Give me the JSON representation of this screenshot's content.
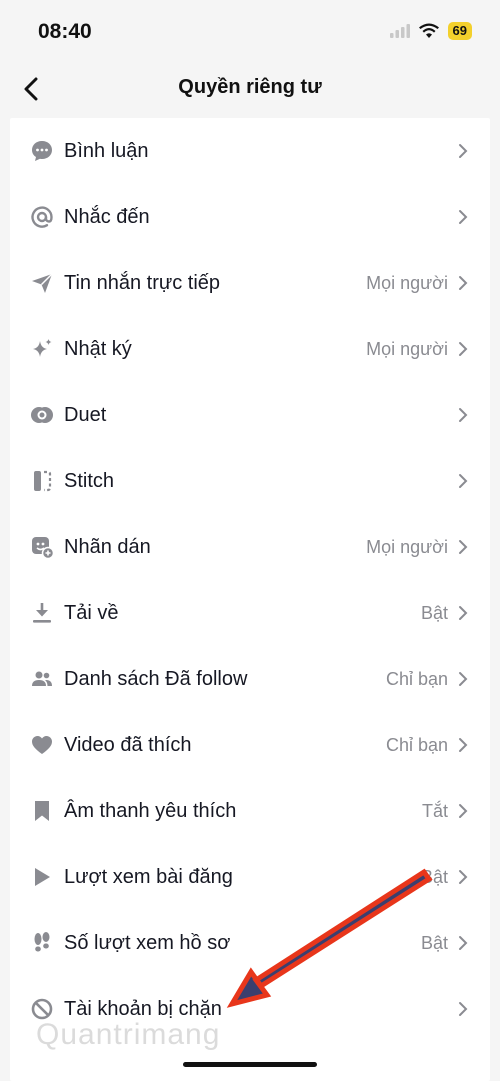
{
  "status_bar": {
    "time": "08:40",
    "battery": "69"
  },
  "header": {
    "title": "Quyền riêng tư"
  },
  "settings": [
    {
      "label": "Bình luận",
      "value": "",
      "icon": "comment-icon"
    },
    {
      "label": "Nhắc đến",
      "value": "",
      "icon": "at-icon"
    },
    {
      "label": "Tin nhắn trực tiếp",
      "value": "Mọi người",
      "icon": "send-icon"
    },
    {
      "label": "Nhật ký",
      "value": "Mọi người",
      "icon": "sparkle-icon"
    },
    {
      "label": "Duet",
      "value": "",
      "icon": "duet-icon"
    },
    {
      "label": "Stitch",
      "value": "",
      "icon": "stitch-icon"
    },
    {
      "label": "Nhãn dán",
      "value": "Mọi người",
      "icon": "sticker-icon"
    },
    {
      "label": "Tải về",
      "value": "Bật",
      "icon": "download-icon"
    },
    {
      "label": "Danh sách Đã follow",
      "value": "Chỉ bạn",
      "icon": "people-icon"
    },
    {
      "label": "Video đã thích",
      "value": "Chỉ bạn",
      "icon": "heart-icon"
    },
    {
      "label": "Âm thanh yêu thích",
      "value": "Tắt",
      "icon": "bookmark-icon"
    },
    {
      "label": "Lượt xem bài đăng",
      "value": "Bật",
      "icon": "play-icon"
    },
    {
      "label": "Số lượt xem hồ sơ",
      "value": "Bật",
      "icon": "footprints-icon"
    },
    {
      "label": "Tài khoản bị chặn",
      "value": "",
      "icon": "block-icon"
    }
  ],
  "watermark": "Quantrimang",
  "colors": {
    "annotation_arrow": "#e8361b",
    "annotation_arrow_fill": "#3b3f6e",
    "battery": "#f3d02c"
  }
}
